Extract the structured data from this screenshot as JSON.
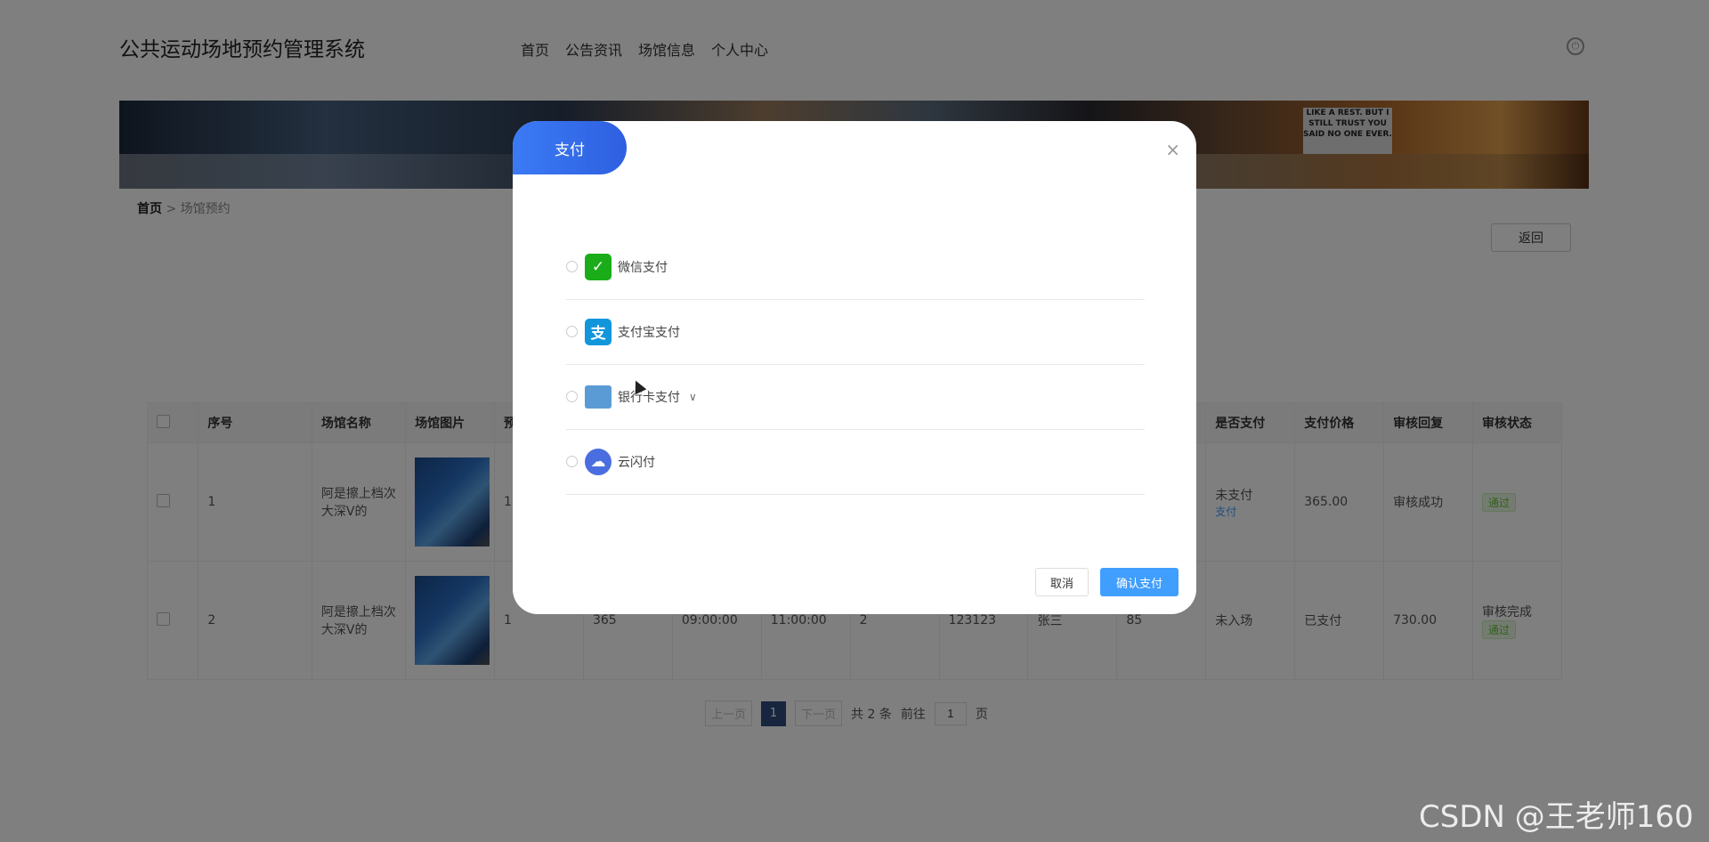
{
  "header": {
    "site_title": "公共运动场地预约管理系统",
    "nav": [
      "首页",
      "公告资讯",
      "场馆信息",
      "个人中心"
    ]
  },
  "banner": {
    "sign_text": "LIKE A REST. BUT I STILL TRUST YOU SAID NO ONE EVER."
  },
  "breadcrumb": {
    "home": "首页",
    "sep": ">",
    "current": "场馆预约"
  },
  "back_button": "返回",
  "table": {
    "columns": [
      "序号",
      "场馆名称",
      "场馆图片",
      "预约",
      "",
      "",
      "",
      "",
      "",
      "",
      "",
      "",
      "是否支付",
      "支付价格",
      "审核回复",
      "审核状态"
    ],
    "rows": [
      {
        "no": "1",
        "name": "阿是擦上档次大深V的",
        "count": "1",
        "price": "",
        "start": "",
        "end": "",
        "qty": "",
        "phone": "",
        "person": "",
        "age": "",
        "enter": "",
        "paid": "未支付",
        "pay_link": "支付",
        "amount": "365.00",
        "reply": "审核成功",
        "status": "通过"
      },
      {
        "no": "2",
        "name": "阿是擦上档次大深V的",
        "count": "1",
        "price": "365",
        "start": "09:00:00",
        "end": "11:00:00",
        "qty": "2",
        "phone": "123123",
        "person": "张三",
        "age": "85",
        "enter": "未入场",
        "paid": "已支付",
        "pay_link": "",
        "amount": "730.00",
        "reply": "审核完成",
        "status": "通过"
      }
    ]
  },
  "pager": {
    "prev": "上一页",
    "current": "1",
    "next": "下一页",
    "total": "共 2 条",
    "goto": "前往",
    "page_value": "1",
    "page_unit": "页"
  },
  "modal": {
    "title": "支付",
    "close": "×",
    "options": [
      {
        "label": "微信支付",
        "icon": "wechat-icon",
        "glyph": "✓"
      },
      {
        "label": "支付宝支付",
        "icon": "alipay-icon",
        "glyph": "支"
      },
      {
        "label": "银行卡支付",
        "icon": "bank-card-icon",
        "glyph": ""
      },
      {
        "label": "云闪付",
        "icon": "unionpay-icon",
        "glyph": "☁"
      }
    ],
    "cancel": "取消",
    "confirm": "确认支付"
  },
  "watermark": "CSDN @王老师160"
}
